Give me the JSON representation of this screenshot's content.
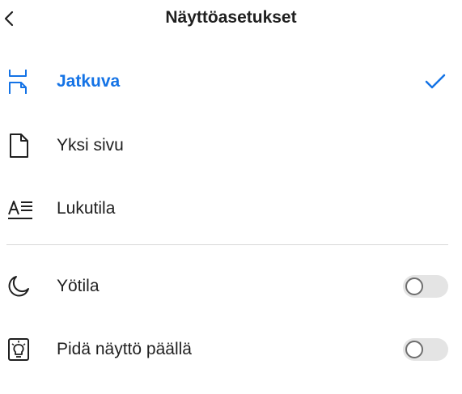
{
  "header": {
    "title": "Näyttöasetukset"
  },
  "view_modes": [
    {
      "label": "Jatkuva",
      "icon": "continuous-scroll-icon",
      "selected": true
    },
    {
      "label": "Yksi sivu",
      "icon": "single-page-icon",
      "selected": false
    },
    {
      "label": "Lukutila",
      "icon": "reading-mode-icon",
      "selected": false
    }
  ],
  "settings": [
    {
      "label": "Yötila",
      "icon": "moon-icon",
      "toggle_on": false
    },
    {
      "label": "Pidä näyttö päällä",
      "icon": "lightbulb-icon",
      "toggle_on": false
    }
  ],
  "colors": {
    "accent": "#1473e6",
    "text": "#1f1f1f",
    "divider": "#d8d8d8",
    "toggle_off_track": "#e4e4e4"
  }
}
